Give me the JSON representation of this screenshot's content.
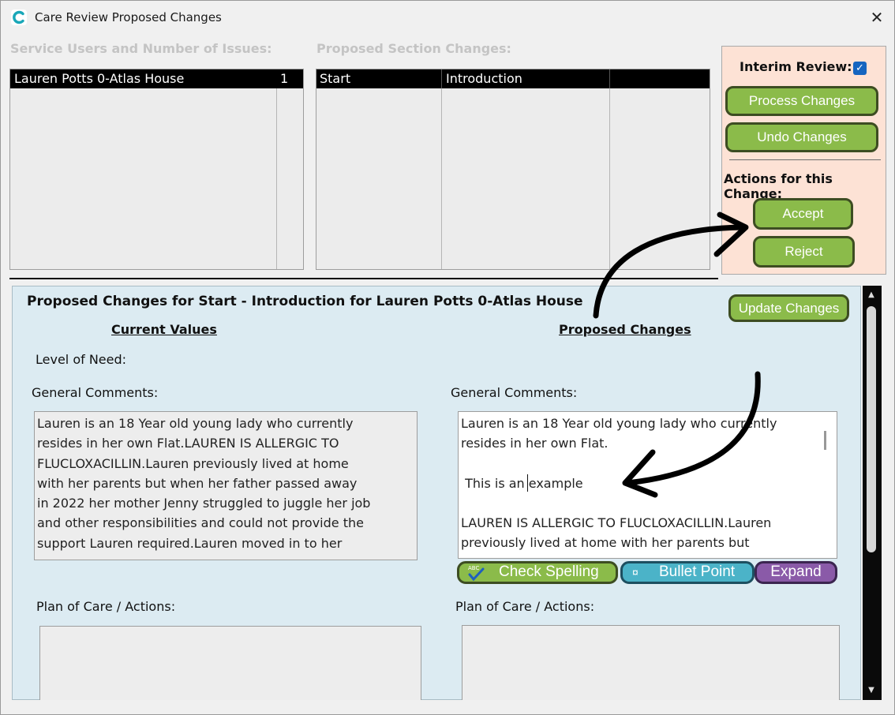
{
  "window": {
    "title": "Care Review Proposed Changes",
    "close_glyph": "✕"
  },
  "service_users": {
    "label": "Service Users and Number of Issues:",
    "rows": [
      {
        "name": "Lauren Potts 0-Atlas House",
        "count": "1"
      }
    ]
  },
  "section_changes": {
    "label": "Proposed Section Changes:",
    "rows": [
      {
        "section": "Start",
        "subsection": "Introduction",
        "extra": ""
      }
    ]
  },
  "actions": {
    "interim_review_label": "Interim Review:",
    "interim_review_checked": true,
    "process_changes": "Process Changes",
    "undo_changes": "Undo Changes",
    "actions_heading": "Actions for this Change:",
    "accept": "Accept",
    "reject": "Reject"
  },
  "details": {
    "heading": "Proposed Changes for Start - Introduction for Lauren Potts 0-Atlas House",
    "update_changes": "Update Changes",
    "current_values_heading": "Current Values",
    "proposed_changes_heading": "Proposed Changes",
    "level_of_need_label": "Level of Need:",
    "general_comments_label_current": "General Comments:",
    "general_comments_label_proposed": "General Comments:",
    "current_general_comments": [
      "Lauren is an 18 Year old young lady who currently",
      "resides in her own Flat.LAUREN IS ALLERGIC TO",
      "FLUCLOXACILLIN.Lauren previously lived at home",
      "with her parents but when her father passed away",
      "in 2022 her mother Jenny struggled to juggle her job",
      "and other responsibilities and could not provide the",
      "support Lauren required.Lauren moved in to her"
    ],
    "proposed_general_comments": [
      "Lauren is an 18 Year old young lady who currently",
      "resides in her own Flat.",
      "",
      " This is an example",
      "",
      "LAUREN IS ALLERGIC TO FLUCLOXACILLIN.Lauren",
      "previously lived at home with her parents but"
    ],
    "check_spelling": "Check Spelling",
    "bullet_point": "Bullet Point",
    "bullet_glyph": "¤",
    "expand": "Expand",
    "plan_of_care_label_current": "Plan of Care / Actions:",
    "plan_of_care_label_proposed": "Plan of Care / Actions:"
  },
  "colors": {
    "button_green": "#8bbb4a",
    "panel_peach": "#fde2d5",
    "panel_blue": "#dcebf2",
    "bullet_teal": "#4bb3c8",
    "expand_purple": "#8a5aa8",
    "selection_black": "#000000"
  }
}
